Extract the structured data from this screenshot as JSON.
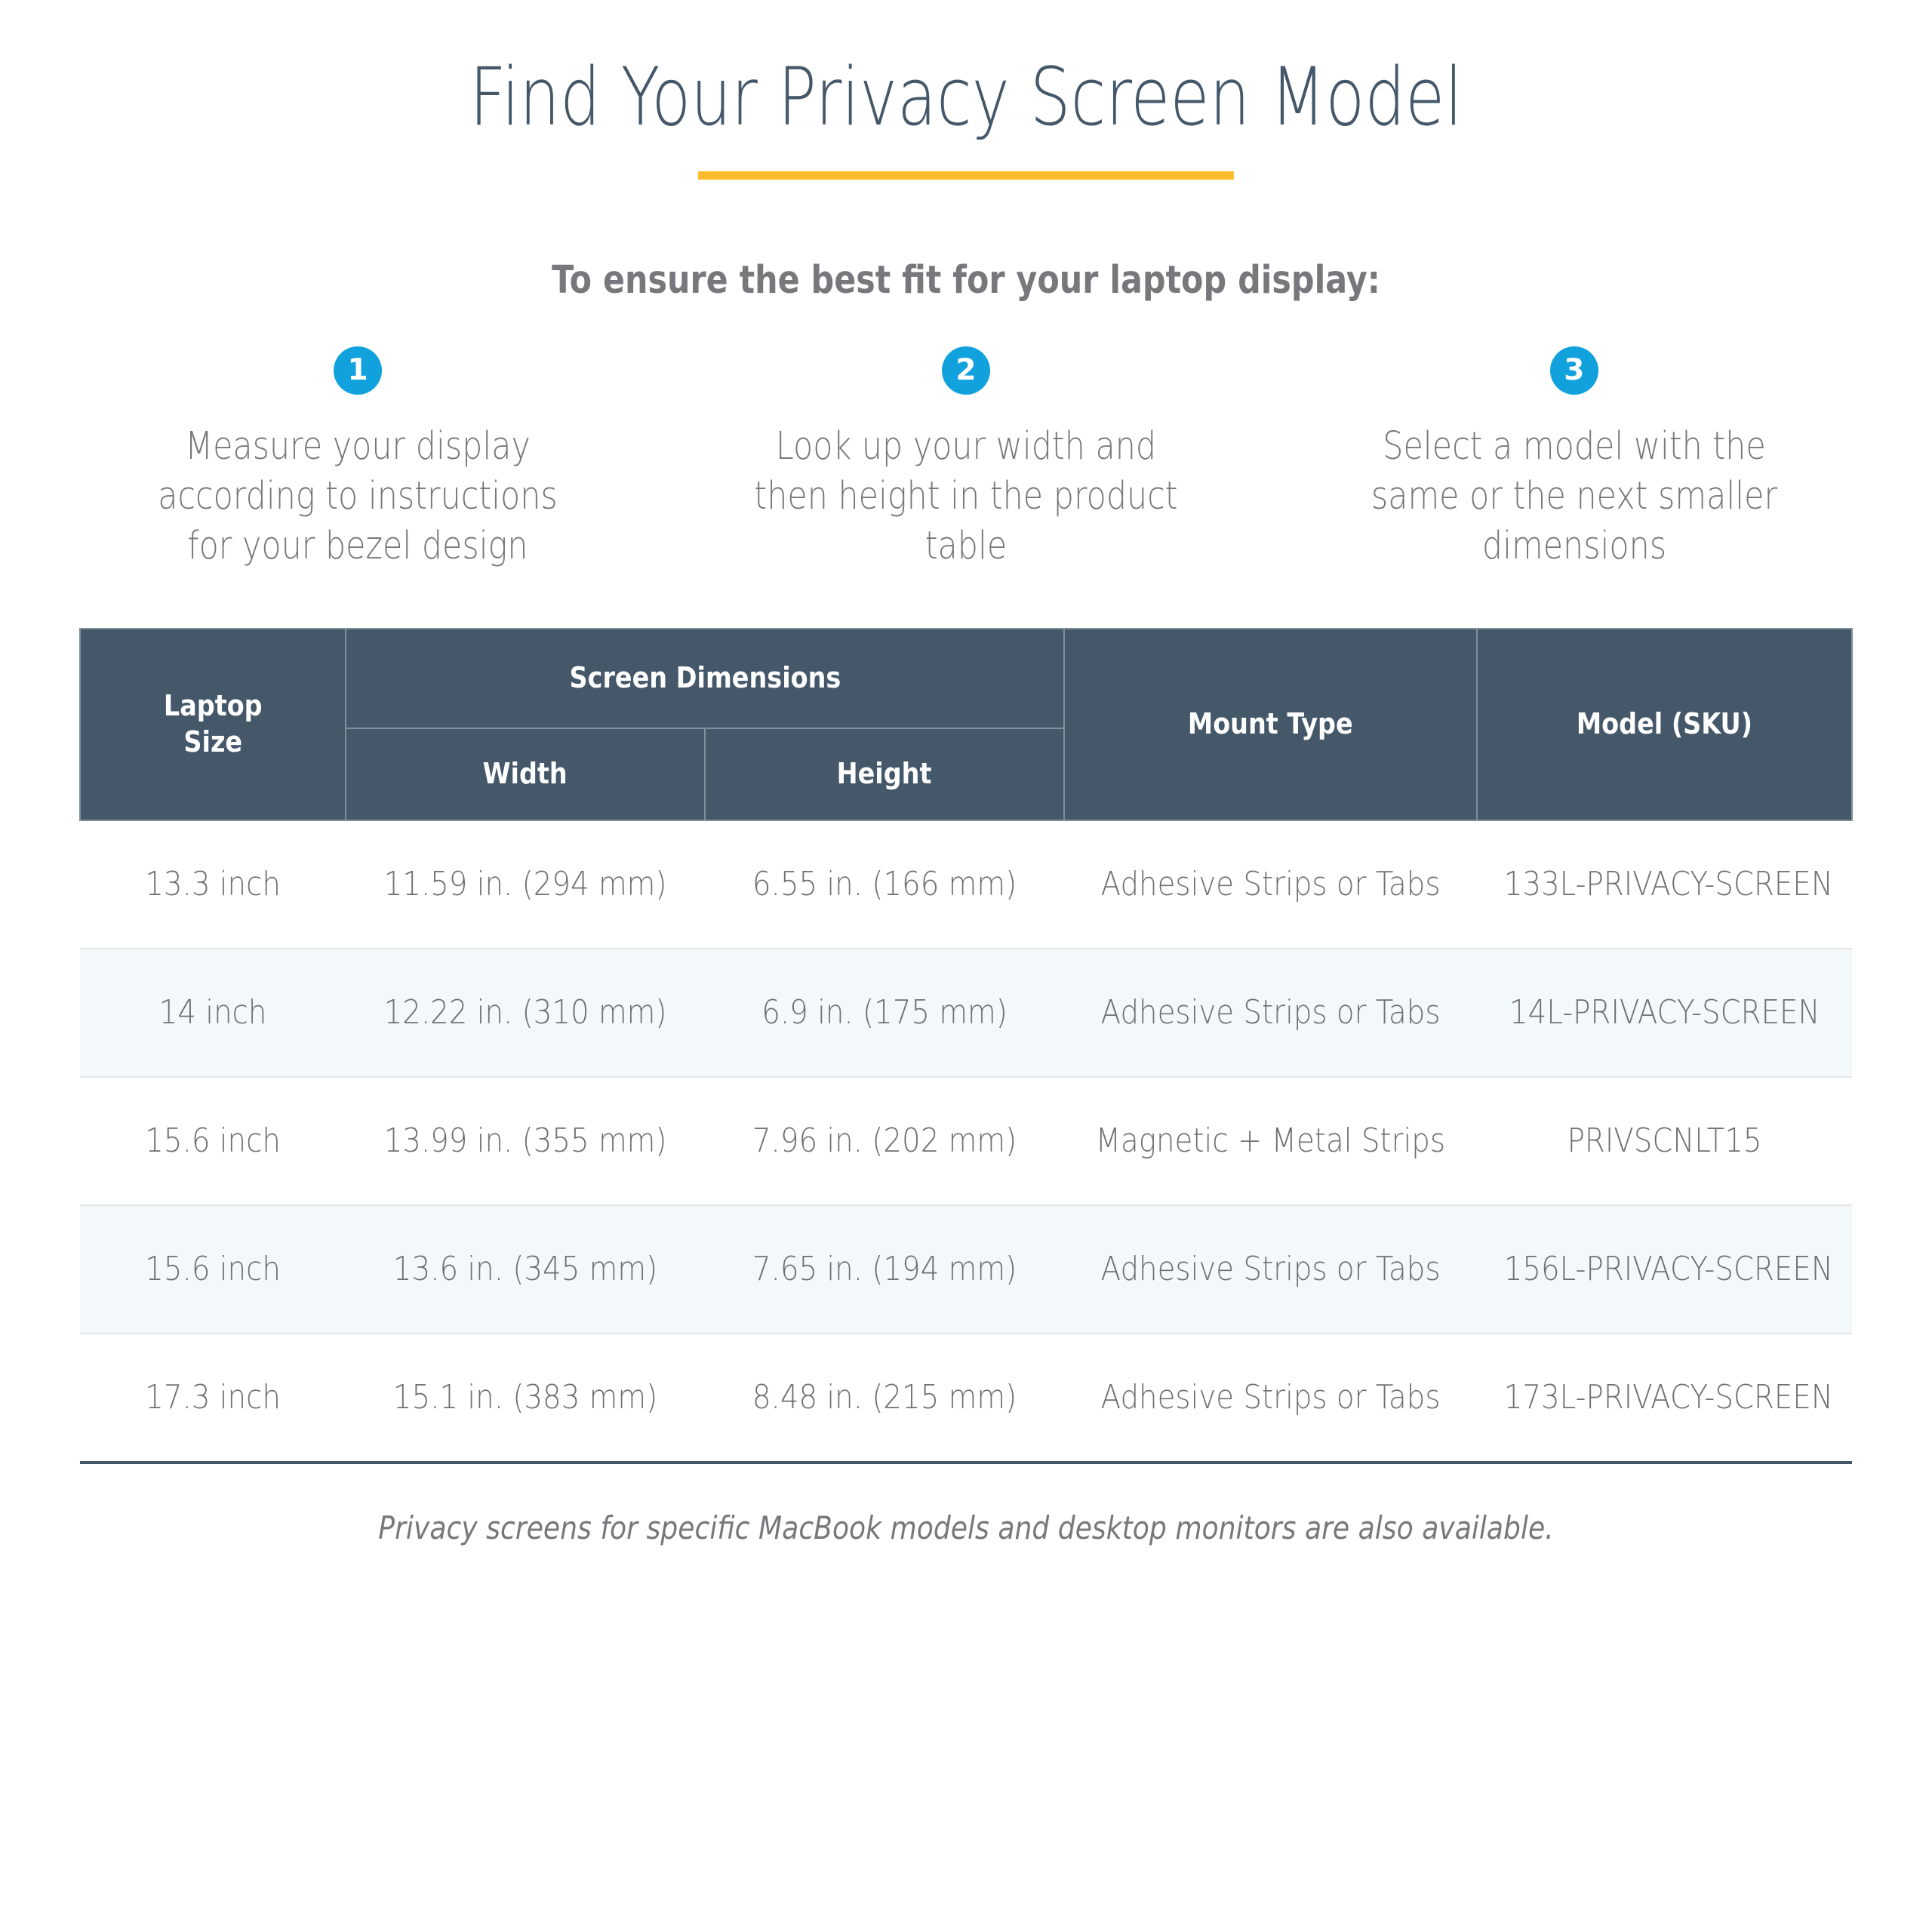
{
  "header": {
    "title": "Find Your Privacy Screen Model",
    "accent_color": "#FBBD2E",
    "subtitle": "To ensure the best fit for your laptop display:"
  },
  "steps": [
    {
      "number": "1",
      "text": "Measure your display according to instructions for your bezel design"
    },
    {
      "number": "2",
      "text": "Look up your width and then height in the product table"
    },
    {
      "number": "3",
      "text": "Select a model with the same or the next smaller dimensions"
    }
  ],
  "step_badge_color": "#11A2DD",
  "table": {
    "header_bg": "#44586A",
    "group_header": "Screen Dimensions",
    "columns": {
      "laptop_size": "Laptop\nSize",
      "laptop_size_line1": "Laptop",
      "laptop_size_line2": "Size",
      "width": "Width",
      "height": "Height",
      "mount_type": "Mount Type",
      "model_sku": "Model (SKU)"
    },
    "rows": [
      {
        "laptop_size": "13.3 inch",
        "width": "11.59 in. (294 mm)",
        "height": "6.55 in. (166 mm)",
        "mount_type": "Adhesive Strips or Tabs",
        "model_sku": "133L-PRIVACY-SCREEN"
      },
      {
        "laptop_size": "14 inch",
        "width": "12.22 in. (310 mm)",
        "height": "6.9 in. (175 mm)",
        "mount_type": "Adhesive Strips or Tabs",
        "model_sku": "14L-PRIVACY-SCREEN"
      },
      {
        "laptop_size": "15.6 inch",
        "width": "13.99 in. (355 mm)",
        "height": "7.96 in. (202 mm)",
        "mount_type": "Magnetic + Metal Strips",
        "model_sku": "PRIVSCNLT15"
      },
      {
        "laptop_size": "15.6 inch",
        "width": "13.6 in. (345 mm)",
        "height": "7.65 in. (194 mm)",
        "mount_type": "Adhesive Strips or Tabs",
        "model_sku": "156L-PRIVACY-SCREEN"
      },
      {
        "laptop_size": "17.3 inch",
        "width": "15.1 in. (383 mm)",
        "height": "8.48 in. (215 mm)",
        "mount_type": "Adhesive Strips or Tabs",
        "model_sku": "173L-PRIVACY-SCREEN"
      }
    ]
  },
  "footnote": "Privacy screens for specific MacBook models and desktop monitors are also available."
}
